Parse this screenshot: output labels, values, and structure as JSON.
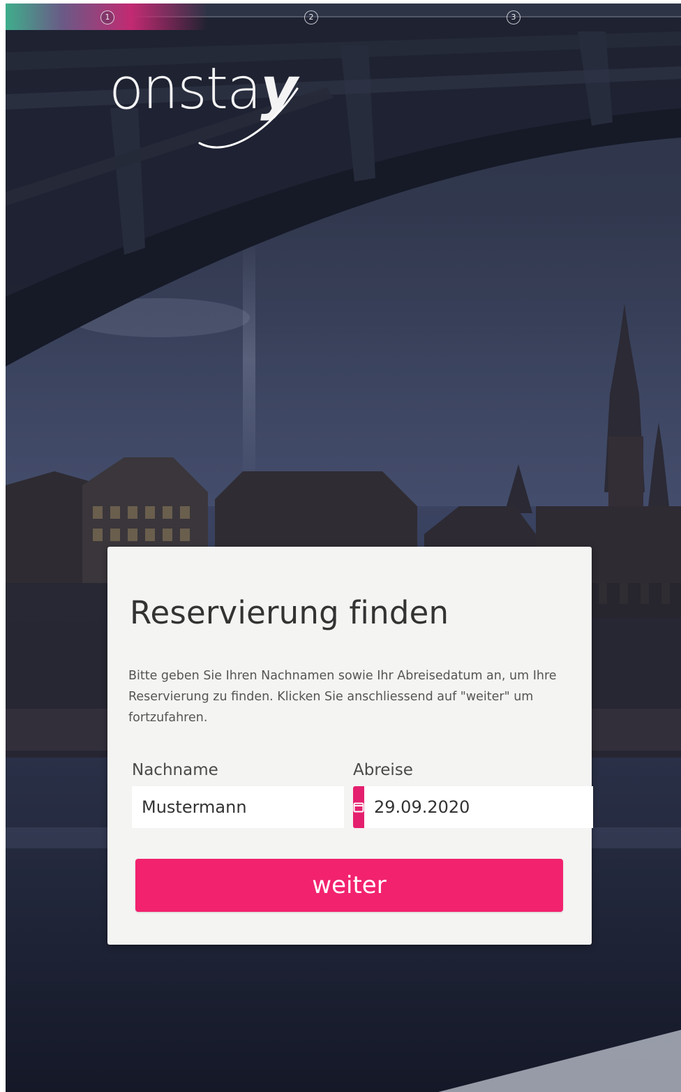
{
  "progress": {
    "fraction": 0.3,
    "steps": [
      {
        "label": "1"
      },
      {
        "label": "2"
      },
      {
        "label": "3"
      }
    ]
  },
  "logo": {
    "text": "onsta",
    "mark": "y"
  },
  "form": {
    "title": "Reservierung finden",
    "description": "Bitte geben Sie Ihren Nachnamen sowie Ihr Abreisedatum an, um Ihre Reservierung zu finden. Klicken Sie anschliessend auf \"weiter\" um fortzufahren.",
    "lastname": {
      "label": "Nachname",
      "value": "Mustermann"
    },
    "departure": {
      "label": "Abreise",
      "value": "29.09.2020",
      "icon": "calendar-icon"
    },
    "submit_label": "weiter"
  },
  "colors": {
    "accent": "#f2226f",
    "card": "#f4f4f2",
    "title": "#333333"
  }
}
